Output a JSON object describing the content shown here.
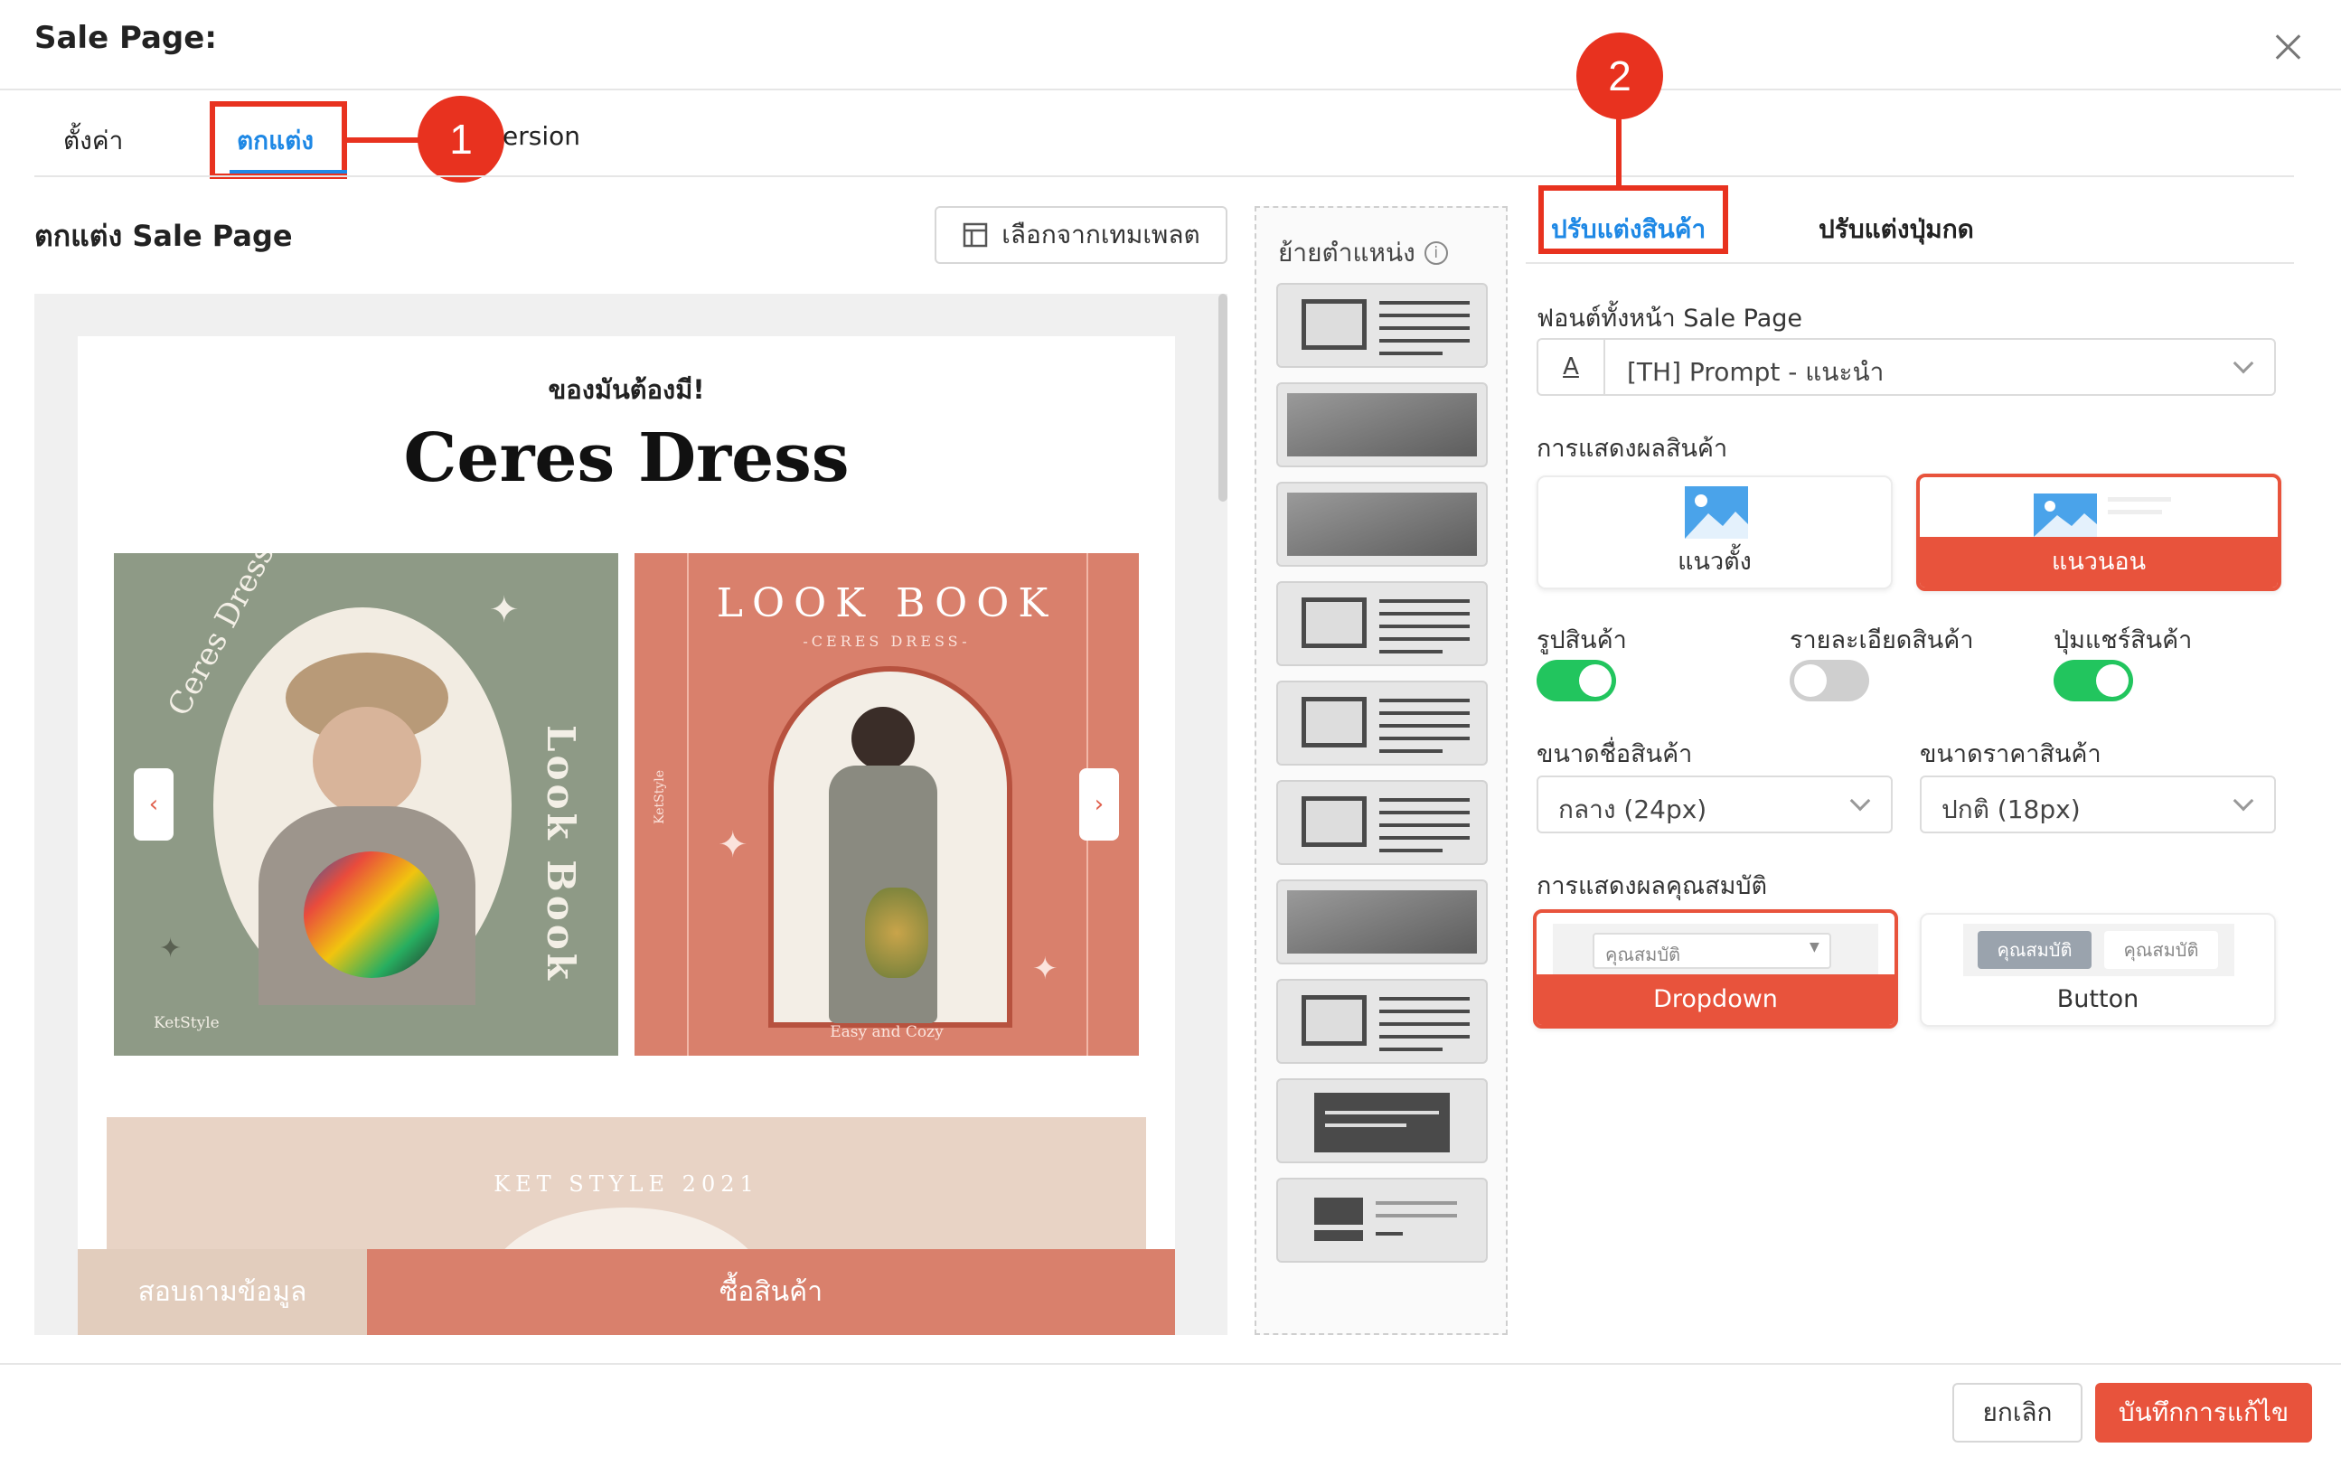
{
  "header": {
    "title": "Sale Page:"
  },
  "tabs": {
    "settings": "ตั้งค่า",
    "design": "ตกแต่ง",
    "conversion": "ersion"
  },
  "badges": {
    "one": "1",
    "two": "2"
  },
  "design": {
    "title": "ตกแต่ง Sale Page",
    "template_button": "เลือกจากเทมเพลต"
  },
  "preview": {
    "tagline": "ของมันต้องมี!",
    "product_name": "Ceres Dress",
    "image1": {
      "arc_text": "Ceres Dress",
      "side_text": "Look Book",
      "brand": "KetStyle"
    },
    "image2": {
      "title": "LOOK BOOK",
      "subtitle": "-CERES DRESS-",
      "side_brand": "KetStyle",
      "caption": "Easy and Cozy"
    },
    "banner_text": "KET STYLE 2021",
    "inquiry_button": "สอบถามข้อมูล",
    "buy_button": "ซื้อสินค้า"
  },
  "layout_panel": {
    "title": "ย้ายตำแหน่ง"
  },
  "right_tabs": {
    "product": "ปรับแต่งสินค้า",
    "button": "ปรับแต่งปุ่มกด"
  },
  "font": {
    "label": "ฟอนต์ทั้งหน้า Sale Page",
    "icon_letter": "A",
    "value": "[TH] Prompt - แนะนำ"
  },
  "product_display": {
    "label": "การแสดงผลสินค้า",
    "vertical": "แนวตั้ง",
    "horizontal": "แนวนอน",
    "selected": "horizontal"
  },
  "toggles": [
    {
      "label": "รูปสินค้า",
      "on": true
    },
    {
      "label": "รายละเอียดสินค้า",
      "on": false
    },
    {
      "label": "ปุ่มแชร์สินค้า",
      "on": true
    }
  ],
  "name_size": {
    "label": "ขนาดชื่อสินค้า",
    "value": "กลาง (24px)"
  },
  "price_size": {
    "label": "ขนาดราคาสินค้า",
    "value": "ปกติ (18px)"
  },
  "attribute_display": {
    "label": "การแสดงผลคุณสมบัติ",
    "dropdown_sample": "คุณสมบัติ",
    "button_sample_1": "คุณสมบัติ",
    "button_sample_2": "คุณสมบัติ",
    "dropdown": "Dropdown",
    "button": "Button",
    "selected": "dropdown"
  },
  "footer": {
    "cancel": "ยกเลิก",
    "save": "บันทึกการแก้ไข"
  },
  "colors": {
    "accent_red": "#e8321f",
    "coral": "#d9806c",
    "blue_tab": "#1e88e5",
    "toggle_on": "#22c55e",
    "toggle_off": "#cfcfcf"
  }
}
